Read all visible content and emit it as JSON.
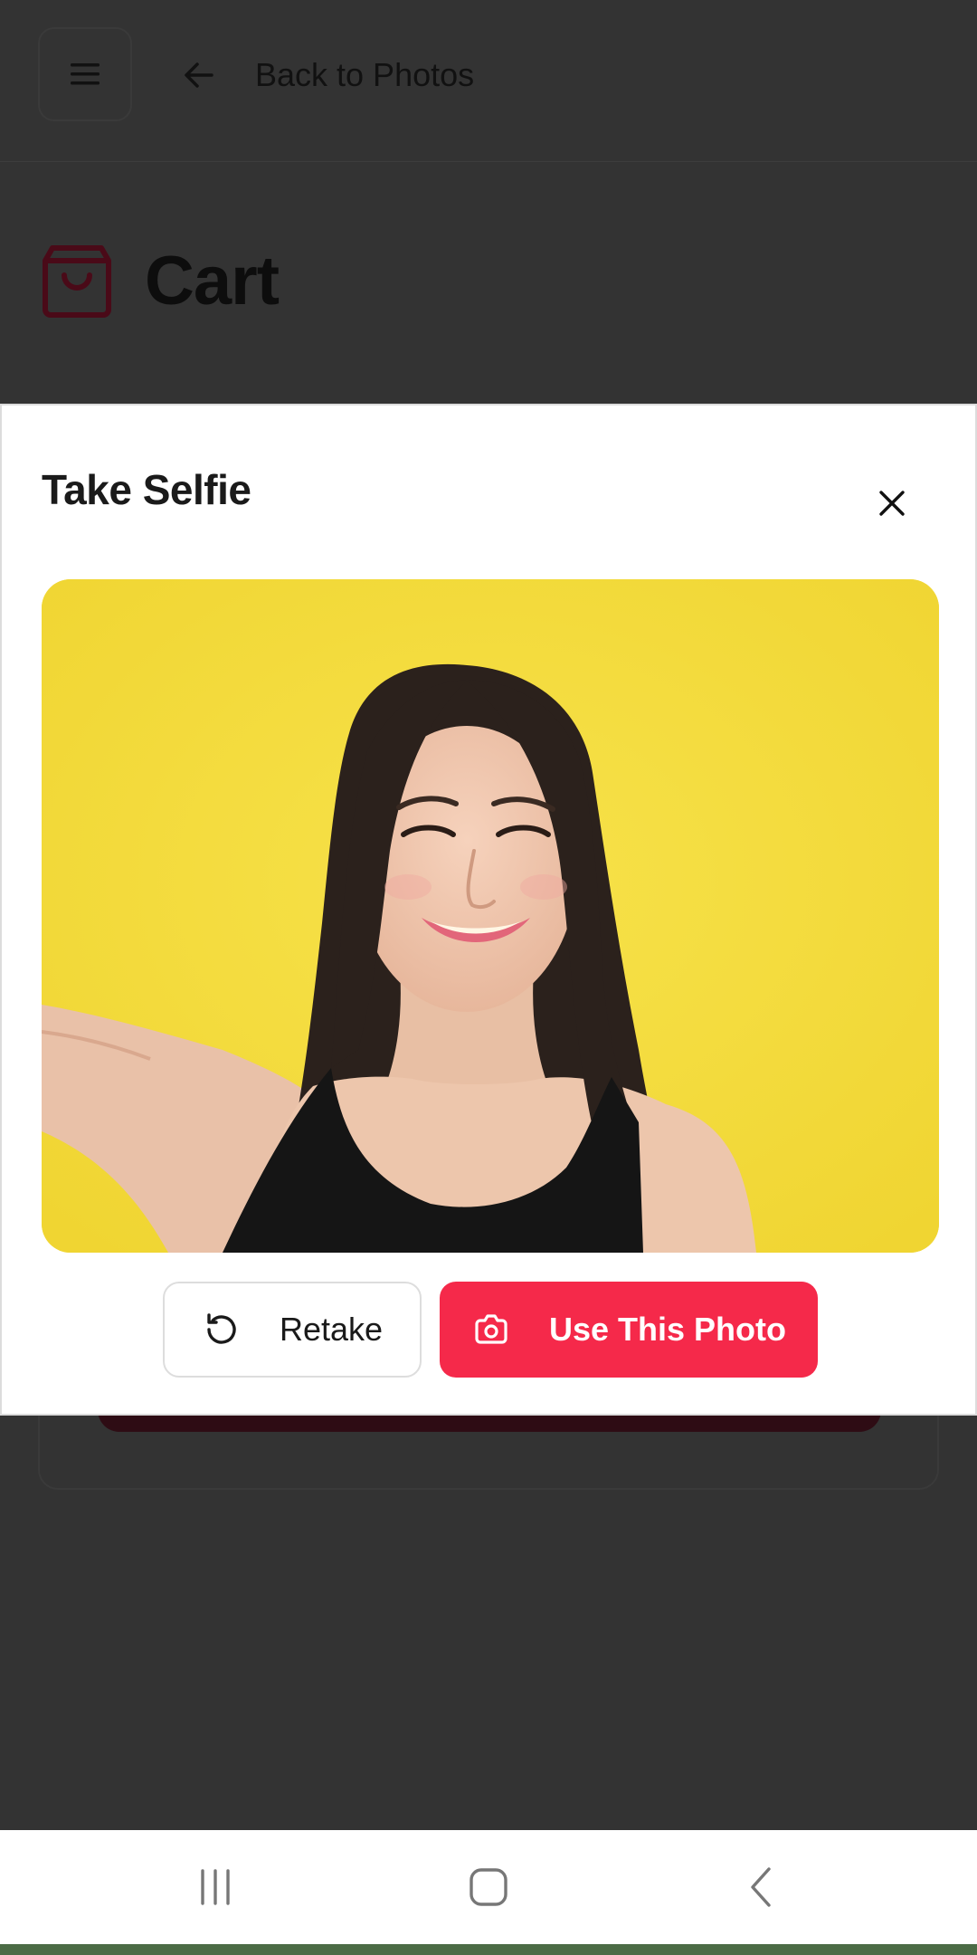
{
  "header": {
    "menu_icon": "hamburger-menu-icon",
    "back_icon": "arrow-left-icon",
    "back_label": "Back to Photos"
  },
  "page": {
    "title": "Cart",
    "title_icon": "shopping-bag-icon"
  },
  "modal": {
    "title": "Take Selfie",
    "close_icon": "close-icon",
    "photo_alt": "selfie preview",
    "retake": {
      "label": "Retake",
      "icon": "rotate-ccw-icon"
    },
    "use_photo": {
      "label": "Use This Photo",
      "icon": "camera-icon"
    }
  },
  "system_nav": {
    "recents_icon": "recents-icon",
    "home_icon": "home-icon",
    "back_icon": "system-back-icon"
  },
  "colors": {
    "accent": "#f5294a",
    "overlay": "#333333",
    "photo_background": "#f4dc3c"
  }
}
